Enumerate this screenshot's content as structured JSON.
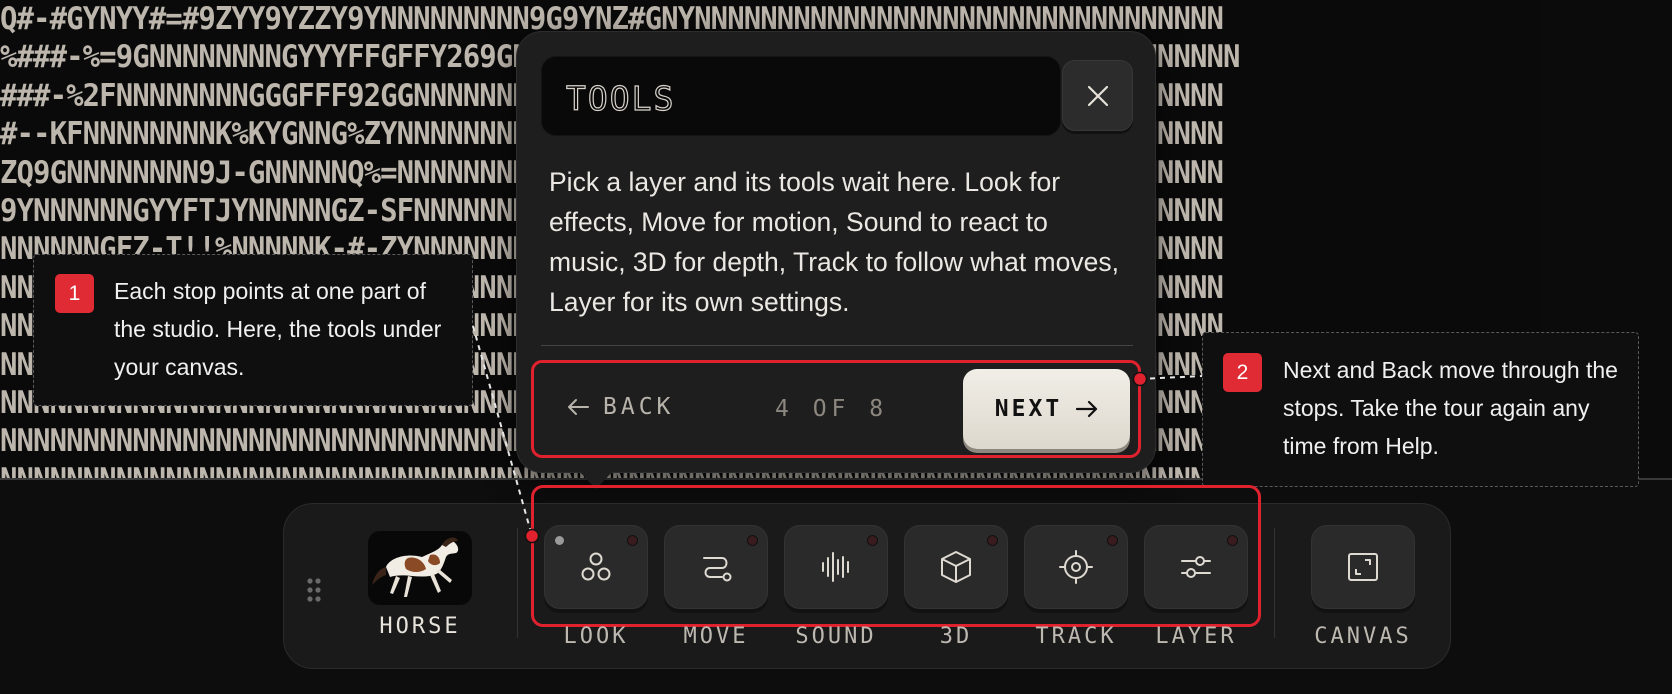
{
  "background_ascii": [
    "Q#-#GYNYY#=#9ZYY9YZZY9YNNNNNNNNN9G9YNZ#GNYNNNNNNNNNNNNNNNNNNNNNNNNNNNNNNNN",
    "%###-%=9GNNNNNNNNGYYYFFGFFY269GNNNNNNGY6==662NGGGGYYYY6YNNGNNNNNNNNNNNNNNNN",
    "###-%2FNNNNNNNNGGGFFF92GGNNNNNNNNNNNNNNNNNNNNNNNNNNNNNNNNNNNNNNNNNNNNNNNNN",
    "#--KFNNNNNNNNK%KYGNNG%ZYNNNNNNNNNNNNNNNNNNNNNNNNNNNNNNNNNNNNNNNNNNNNNNNNNN",
    "ZQ9GNNNNNNNN9J-GNNNNNQ%=NNNNNNNNNNNNNNNNNNNNNNNNNNNNNNNNNNNNNNNNNNNNNNNNNN",
    "9YNNNNNNGYYFTJYNNNNNGZ-SFNNNNNNNNNNNNNNNNNNNNNNNNNNNNNNNNNNNNNNNNNNNNNNNNN",
    "NNNNNNGFZ-T!!%NNNNNK-#-ZYNNNNNNNNNNNNNNNNNNNNNNNNNNNNNNNNNNNNNNNNNNNNNNNNN",
    "NNNNNNNNN9QQ==YNNNNN9%=YNNNNNNNNNNNNNNNNNNNNNNNNNNNNNNNNNNNNNNNNNNNNNNNNNN",
    "NNNNNNNNNNNNNNNNNNNNNNNNNNNNNNNNNNNNNNNNNNNNNNNNNNNNNNNNNNNNNNNNNNNNNNNNNN",
    "NNNNNNNNNNNNNNNNNNNNNNNNNNNNNNNNNNNNNNNNNNNNNNNNNNNNNNNNNNNNNNNNNNNNNNNNNN",
    "NNNNNNNNNNNNNNNNNNNNNNNNNNNNNNNNNNNNNNNNNNNNNNNNNNNNNNNNNNNNNNNNNNNNNNNNNN",
    "NNNNNNNNNNNNNNNNNNNNNNNNNNNNNNNNNNNNNNNNNNNNNNNNNNNNNNNNNNNNNNNNNNNNNNNNNN",
    "NNNNNNNNNNNNNNNNNNNNNNNNNNNNNNNNNNNNNNNNNNNNNNNNNNNNNNNNNNNNNNNNNNNNNNNNNN"
  ],
  "popover": {
    "title": "TOOLS",
    "description": "Pick a layer and its tools wait here. Look for effects, Move for motion, Sound to react to music, 3D for depth, Track to follow what moves, Layer for its own settings.",
    "back_label": "BACK",
    "step_counter": "4 OF 8",
    "next_label": "NEXT",
    "close_icon": "close-icon"
  },
  "callouts": [
    {
      "number": "1",
      "text": "Each stop points at one part of the studio. Here, the tools under your canvas."
    },
    {
      "number": "2",
      "text": "Next and Back move through the stops. Take the tour again any time from Help."
    }
  ],
  "toolbar": {
    "layer_name": "HORSE",
    "tools": [
      {
        "label": "LOOK",
        "icon": "look-icon"
      },
      {
        "label": "MOVE",
        "icon": "move-icon"
      },
      {
        "label": "SOUND",
        "icon": "sound-icon"
      },
      {
        "label": "3D",
        "icon": "cube-icon"
      },
      {
        "label": "TRACK",
        "icon": "track-icon"
      },
      {
        "label": "LAYER",
        "icon": "sliders-icon"
      }
    ],
    "canvas_label": "CANVAS"
  },
  "colors": {
    "highlight": "#e0222f",
    "accent_button": "#ebe7de",
    "panel": "#1e1e1e",
    "ascii": "#bdb6ad"
  }
}
